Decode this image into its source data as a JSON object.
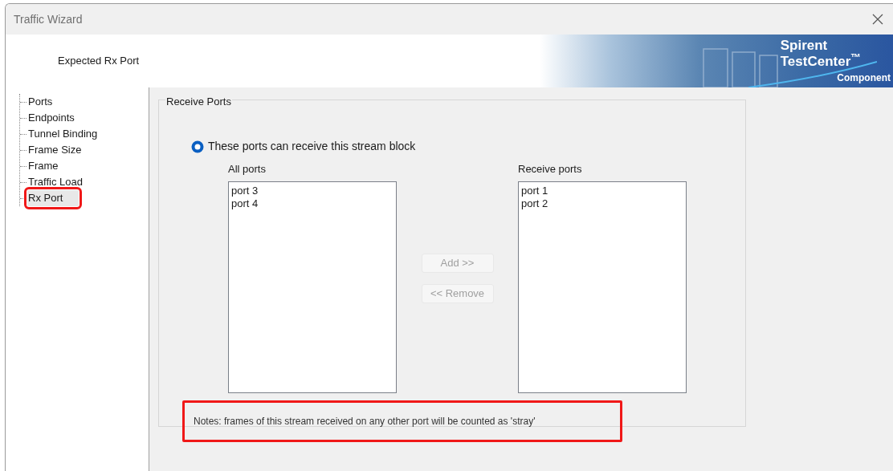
{
  "window": {
    "title": "Traffic Wizard"
  },
  "header": {
    "page_title": "Expected Rx Port",
    "banner": {
      "brand_lines": [
        "Spirent",
        "TestCenter$^{™}$"
      ],
      "subtitle": "Component"
    }
  },
  "tree": {
    "items": [
      {
        "label": "Ports",
        "selected": false,
        "highlighted": false
      },
      {
        "label": "Endpoints",
        "selected": false,
        "highlighted": false
      },
      {
        "label": "Tunnel Binding",
        "selected": false,
        "highlighted": false
      },
      {
        "label": "Frame Size",
        "selected": false,
        "highlighted": false
      },
      {
        "label": "Frame",
        "selected": false,
        "highlighted": false
      },
      {
        "label": "Traffic Load",
        "selected": false,
        "highlighted": false
      },
      {
        "label": "Rx Port",
        "selected": true,
        "highlighted": true
      }
    ]
  },
  "group": {
    "title": "Receive Ports",
    "radio": {
      "label": "These ports can receive this stream block",
      "selected": true
    },
    "all_ports": {
      "label": "All ports",
      "items": [
        "port 3",
        "port 4"
      ]
    },
    "receive_ports": {
      "label": "Receive ports",
      "items": [
        "port 1",
        "port 2"
      ]
    },
    "buttons": [
      {
        "label": "Add >>",
        "disabled": true
      },
      {
        "label": "<< Remove",
        "disabled": true
      }
    ]
  },
  "notes": {
    "text": "Notes: frames of this stream received on any other port will be counted as 'stray'",
    "highlighted": true
  }
}
